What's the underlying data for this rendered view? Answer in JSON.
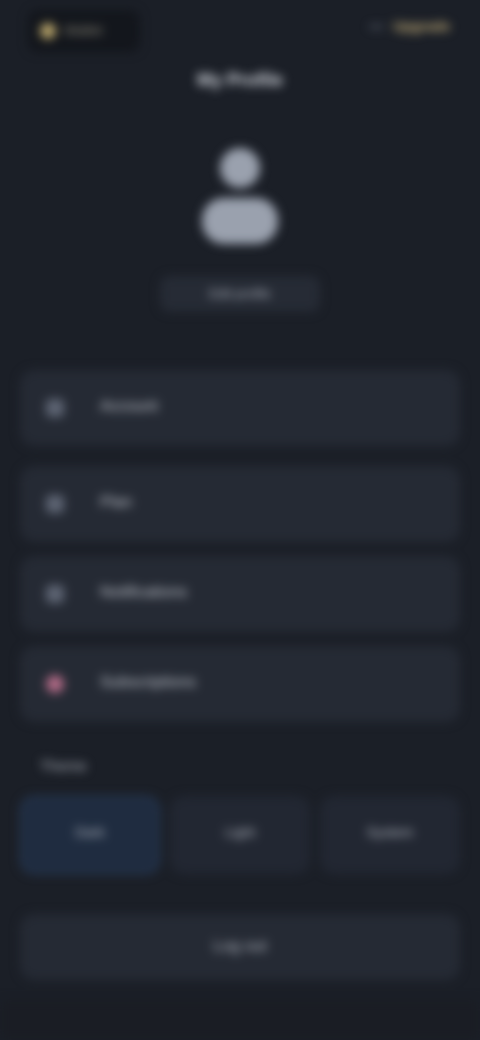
{
  "header": {
    "brand_label": "Wallet",
    "right_muted": "•••",
    "right_action": "Upgrade"
  },
  "profile": {
    "title": "My Profile",
    "subtitle": "Edit profile"
  },
  "rows": [
    {
      "label": "Account",
      "icon": "user-icon"
    },
    {
      "label": "Plan",
      "icon": "card-icon"
    },
    {
      "label": "Notifications",
      "icon": "bell-icon"
    },
    {
      "label": "Subscriptions",
      "icon": "heart-icon"
    }
  ],
  "section": {
    "title": "Theme"
  },
  "tiles": [
    {
      "label": "Dark",
      "active": true
    },
    {
      "label": "Light",
      "active": false
    },
    {
      "label": "System",
      "active": false
    }
  ],
  "bottom": {
    "label": "Log out"
  },
  "colors": {
    "background": "#1b1f27",
    "card": "#252a34",
    "accent_gold": "#c9b27a",
    "accent_blue": "#1f2c40"
  }
}
